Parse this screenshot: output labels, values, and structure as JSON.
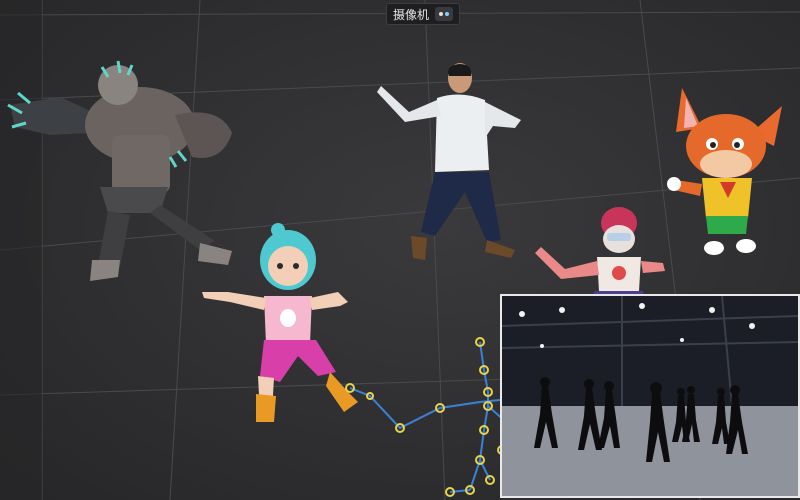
{
  "viewport": {
    "camera_label": "摄像机",
    "camera_icon": "camera-switch-icon"
  },
  "characters": [
    {
      "id": "monster",
      "name": "werewolf-monster-character",
      "icon": "monster"
    },
    {
      "id": "man",
      "name": "live-actor-man-character",
      "icon": "human"
    },
    {
      "id": "fox",
      "name": "orange-fox-cartoon-character",
      "icon": "fox"
    },
    {
      "id": "girl",
      "name": "teal-hair-girl-character",
      "icon": "girl"
    },
    {
      "id": "robot",
      "name": "helmet-robot-girl-character",
      "icon": "robot"
    }
  ],
  "inset": {
    "description_icon": "mocap-studio-video-icon",
    "performer_count": 10
  },
  "colors": {
    "skeleton_joint": "#e8d24a",
    "skeleton_bone": "#3b82d6",
    "inset_border": "#e9e9e9"
  }
}
